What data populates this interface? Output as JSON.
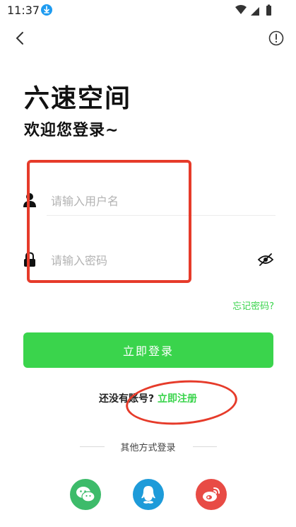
{
  "status_bar": {
    "time": "11:37"
  },
  "header": {
    "app_title": "六速空间",
    "welcome": "欢迎您登录~"
  },
  "form": {
    "username_placeholder": "请输入用户名",
    "password_placeholder": "请输入密码",
    "forgot_password": "忘记密码?"
  },
  "actions": {
    "login_label": "立即登录"
  },
  "register": {
    "prefix": "还没有账号?",
    "link": "立即注册"
  },
  "other_login": {
    "label": "其他方式登录",
    "providers": [
      {
        "name": "wechat",
        "icon": "wechat-icon"
      },
      {
        "name": "qq",
        "icon": "qq-icon"
      },
      {
        "name": "weibo",
        "icon": "weibo-icon"
      }
    ]
  },
  "colors": {
    "accent": "#3ad44c",
    "annotation": "#e63b2a",
    "wechat": "#3dbb6a",
    "qq": "#1e9bd9",
    "weibo": "#e84b45"
  }
}
